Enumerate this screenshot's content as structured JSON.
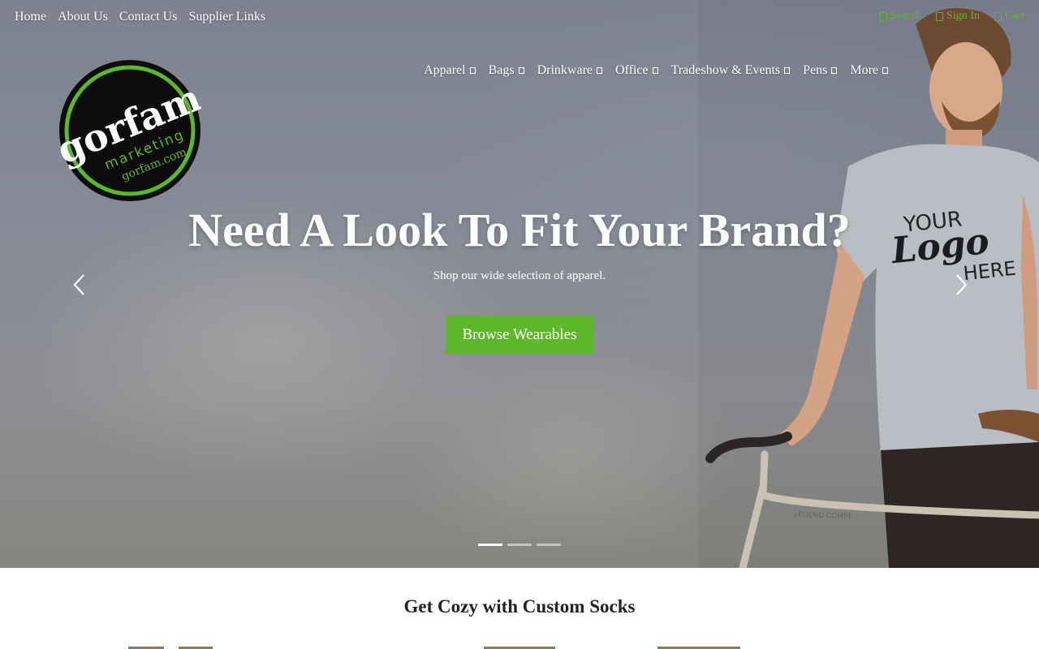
{
  "utility_nav": {
    "links": [
      "Home",
      "About Us",
      "Contact Us",
      "Supplier Links"
    ],
    "search": "Search",
    "sign_in": "Sign In",
    "cart": "Cart"
  },
  "logo": {
    "wordmark": "gorfam",
    "tagline": "marketing",
    "url": "gorfam.com"
  },
  "main_nav": {
    "items": [
      "Apparel",
      "Bags",
      "Drinkware",
      "Office",
      "Tradeshow & Events",
      "Pens",
      "More"
    ]
  },
  "hero": {
    "headline": "Need A Look To Fit Your Brand?",
    "subline": "Shop our wide selection of apparel.",
    "cta_label": "Browse Wearables",
    "shirt_print": [
      "YOUR",
      "Logo",
      "HERE"
    ],
    "slide_count": 3,
    "active_slide": 1
  },
  "section": {
    "title": "Get Cozy with Custom Socks"
  },
  "colors": {
    "accent": "#5cb82a",
    "hero_bg": "#858a95",
    "logo_ring": "#5cb82a"
  },
  "icons": [
    "search-icon",
    "user-icon",
    "cart-icon",
    "chevron-down-icon",
    "chevron-left-icon",
    "chevron-right-icon"
  ]
}
